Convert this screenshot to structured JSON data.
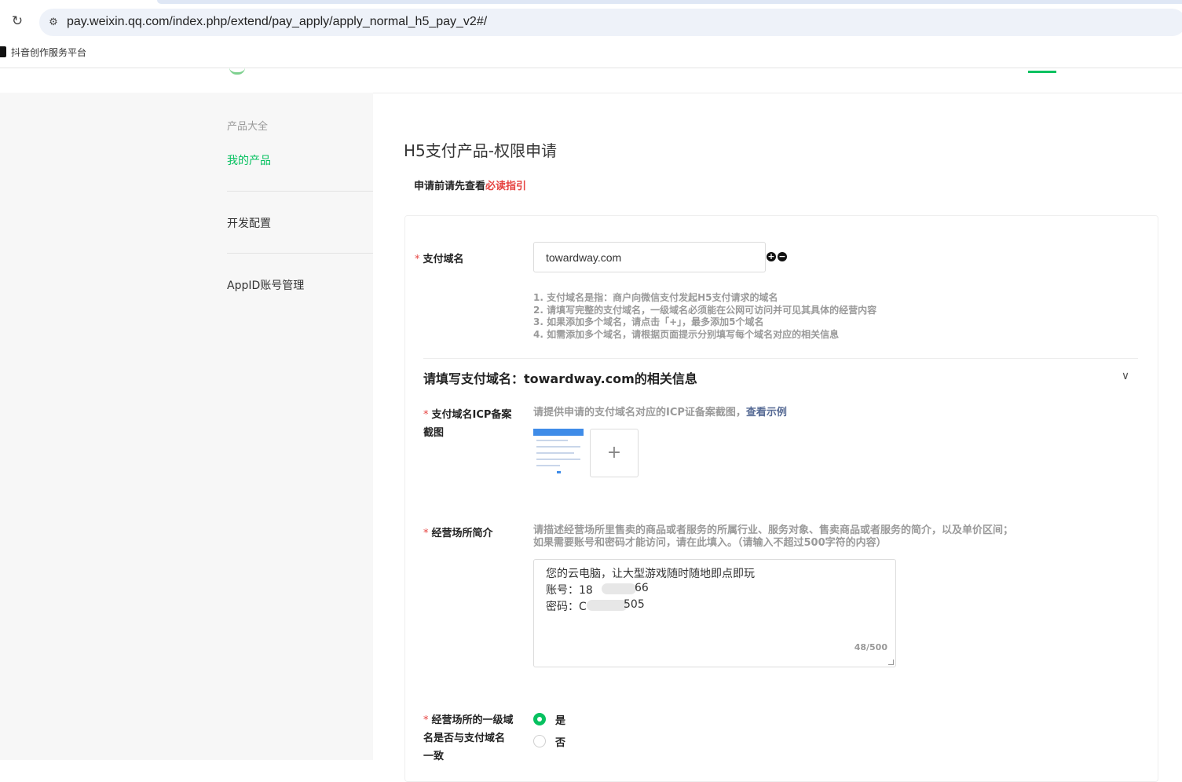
{
  "browser": {
    "url": "pay.weixin.qq.com/index.php/extend/pay_apply/apply_normal_h5_pay_v2#/",
    "bookmark": "抖音创作服务平台"
  },
  "sidebar": {
    "section_title": "产品大全",
    "items": [
      {
        "label": "我的产品",
        "active": true
      },
      {
        "label": "开发配置",
        "active": false
      },
      {
        "label": "AppID账号管理",
        "active": false
      }
    ]
  },
  "main": {
    "title": "H5支付产品-权限申请",
    "notice_prefix": "申请前请先查看",
    "notice_link": "必读指引",
    "domain_field": {
      "label": "支付域名",
      "value": "towardway.com",
      "hints": [
        "1. 支付域名是指：商户向微信支付发起H5支付请求的域名",
        "2. 请填写完整的支付域名，一级域名必须能在公网可访问并可见其具体的经营内容",
        "3. 如果添加多个域名，请点击「+」，最多添加5个域名",
        "4. 如需添加多个域名，请根据页面提示分别填写每个域名对应的相关信息"
      ]
    },
    "section_title": "请填写支付域名：towardway.com的相关信息",
    "icp": {
      "label_line1": "支付域名ICP备案",
      "label_line2": "截图",
      "desc": "请提供申请的支付域名对应的ICP证备案截图，",
      "link": "查看示例",
      "upload_symbol": "+"
    },
    "business_intro": {
      "label": "经营场所简介",
      "desc_line1": "请描述经营场所里售卖的商品或者服务的所属行业、服务对象、售卖商品或者服务的简介，以及单价区间；",
      "desc_line2": "如果需要账号和密码才能访问，请在此填入。（请输入不超过500字符的内容）",
      "text_line1": "您的云电脑，让大型游戏随时随地即点即玩",
      "text_line2_start": "账号：18",
      "text_line2_end": "66",
      "text_line3_start": "密码：C",
      "text_line3_end": "505",
      "counter": "48/500"
    },
    "domain_match": {
      "label_line1": "经营场所的一级域",
      "label_line2": "名是否与支付域名",
      "label_line3": "一致",
      "option_yes": "是",
      "option_no": "否",
      "selected": "是"
    }
  },
  "colors": {
    "brand_green": "#07c160",
    "required_red": "#e64340",
    "link_blue": "#576b95"
  },
  "icons": {
    "reload": "reload-icon",
    "site_info": "site-info-icon",
    "add": "plus-circle-icon",
    "remove": "minus-circle-icon",
    "collapse": "chevron-down-icon"
  }
}
